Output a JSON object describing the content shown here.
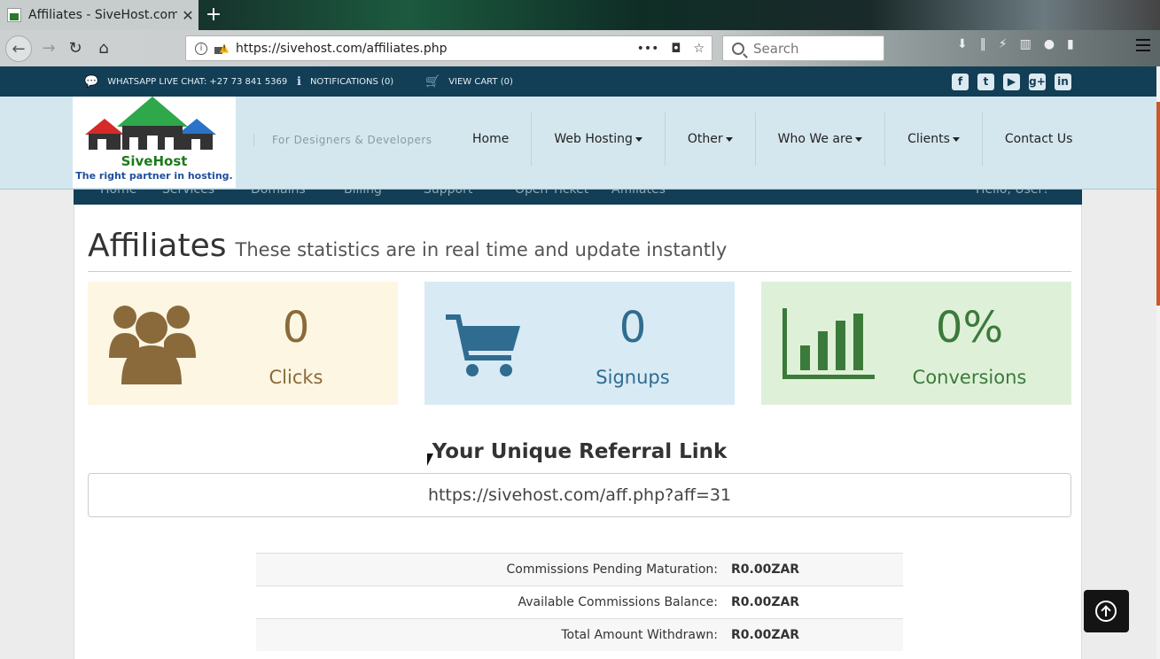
{
  "browser": {
    "tab_title": "Affiliates - SiveHost.com",
    "tab_close": "✕",
    "new_tab": "+",
    "url": "https://sivehost.com/affiliates.php",
    "search_placeholder": "Search",
    "url_more": "•••"
  },
  "topbar": {
    "whatsapp": "WHATSAPP LIVE CHAT: +27 73 841 5369",
    "notifications": "NOTIFICATIONS (0)",
    "cart": "VIEW CART (0)",
    "social": [
      "f",
      "t",
      "▶",
      "g+",
      "in"
    ]
  },
  "header": {
    "logo_brand": "SiveHost",
    "logo_tag": "The right partner in hosting.",
    "tagline": "For Designers & Developers",
    "nav": [
      {
        "label": "Home",
        "dropdown": false
      },
      {
        "label": "Web Hosting",
        "dropdown": true
      },
      {
        "label": "Other",
        "dropdown": true
      },
      {
        "label": "Who We are",
        "dropdown": true
      },
      {
        "label": "Clients",
        "dropdown": true
      },
      {
        "label": "Contact Us",
        "dropdown": false
      }
    ]
  },
  "subnav": [
    "Home",
    "Services",
    "Domains",
    "Billing",
    "Support",
    "Open Ticket",
    "Affiliates",
    "Hello, User!"
  ],
  "page": {
    "title": "Affiliates",
    "subtitle": "These statistics are in real time and update instantly"
  },
  "stats": {
    "clicks": {
      "value": "0",
      "label": "Clicks"
    },
    "signups": {
      "value": "0",
      "label": "Signups"
    },
    "conversions": {
      "value": "0%",
      "label": "Conversions"
    }
  },
  "referral": {
    "title": "Your Unique Referral Link",
    "link": "https://sivehost.com/aff.php?aff=31"
  },
  "commissions": [
    {
      "label": "Commissions Pending Maturation:",
      "value": "R0.00ZAR"
    },
    {
      "label": "Available Commissions Balance:",
      "value": "R0.00ZAR"
    },
    {
      "label": "Total Amount Withdrawn:",
      "value": "R0.00ZAR"
    }
  ],
  "colors": {
    "topbar": "#123e56",
    "header": "#d5e7ee",
    "clicks": "#8a6a3b",
    "signups": "#2f6c90",
    "conversions": "#3b7a3b"
  }
}
